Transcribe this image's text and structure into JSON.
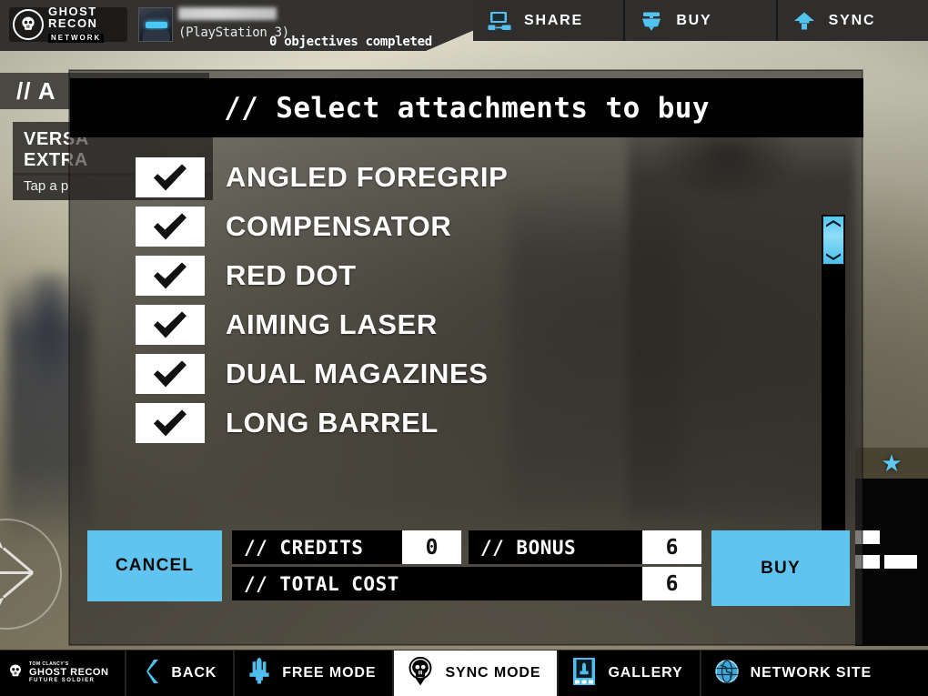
{
  "header": {
    "brand": {
      "line1": "GHOST",
      "line2": "RECON",
      "line3": "NETWORK",
      "icon": "ghost-skull-icon"
    },
    "avatar_icon": "player-avatar-icon",
    "username_redacted": "",
    "platform": "(PlayStation 3)",
    "objectives": "0 objectives completed",
    "actions": [
      {
        "label": "SHARE",
        "icon": "share-screen-icon"
      },
      {
        "label": "BUY",
        "icon": "buy-cart-icon"
      },
      {
        "label": "SYNC",
        "icon": "sync-upload-arrow-icon"
      }
    ]
  },
  "page_behind": {
    "title": "// A",
    "card_line1": "VERSA",
    "card_line2": "EXTRA",
    "hint": "Tap a p",
    "right_panel_star": "★"
  },
  "modal": {
    "title": "// Select attachments to buy",
    "attachments": [
      {
        "label": "ANGLED FOREGRIP",
        "checked": true
      },
      {
        "label": "COMPENSATOR",
        "checked": true
      },
      {
        "label": "RED DOT",
        "checked": true
      },
      {
        "label": "AIMING LASER",
        "checked": true
      },
      {
        "label": "DUAL MAGAZINES",
        "checked": true
      },
      {
        "label": "LONG BARREL",
        "checked": true
      }
    ],
    "scrollbar": {
      "position": "top",
      "thumb_icon": "double-chevron-icon"
    },
    "footer": {
      "cancel_label": "CANCEL",
      "buy_label": "BUY",
      "credits_label": "// CREDITS",
      "credits_value": "0",
      "bonus_label": "// BONUS",
      "bonus_value": "6",
      "total_label": "// TOTAL COST",
      "total_value": "6"
    }
  },
  "bottom_nav": {
    "brand": {
      "l1": "TOM CLANCY'S",
      "l2": "GHOST RECON",
      "l3": "FUTURE SOLDIER"
    },
    "items": [
      {
        "label": "BACK",
        "icon": "chevron-left-icon",
        "active": false
      },
      {
        "label": "FREE MODE",
        "icon": "jet-icon",
        "active": false
      },
      {
        "label": "SYNC MODE",
        "icon": "skull-icon",
        "active": true
      },
      {
        "label": "GALLERY",
        "icon": "film-strip-icon",
        "active": false
      },
      {
        "label": "NETWORK SITE",
        "icon": "globe-icon",
        "active": false
      }
    ]
  },
  "colors": {
    "accent_blue": "#5fc4f0",
    "panel_black": "#000000",
    "header_gray": "#333230"
  }
}
